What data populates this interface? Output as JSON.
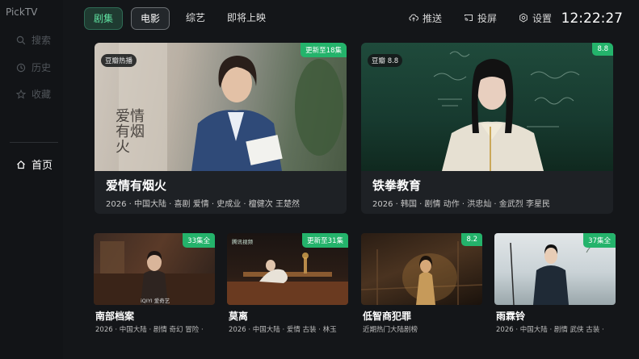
{
  "app": {
    "brand": "PickTV"
  },
  "sidebar": {
    "items": [
      {
        "label": "搜索",
        "icon": "search-icon"
      },
      {
        "label": "历史",
        "icon": "history-icon"
      },
      {
        "label": "收藏",
        "icon": "star-icon"
      }
    ],
    "home": {
      "label": "首页",
      "icon": "home-icon"
    }
  },
  "nav": {
    "tabs": [
      {
        "label": "剧集",
        "state": "active"
      },
      {
        "label": "电影",
        "state": "focused"
      },
      {
        "label": "综艺",
        "state": "normal"
      },
      {
        "label": "即将上映",
        "state": "normal"
      }
    ],
    "tools": [
      {
        "label": "推送",
        "icon": "upload-cloud-icon"
      },
      {
        "label": "投屏",
        "icon": "cast-icon"
      },
      {
        "label": "设置",
        "icon": "settings-icon"
      }
    ],
    "clock": "12:22:27"
  },
  "featured": [
    {
      "title": "爱情有烟火",
      "meta": "2026 · 中国大陆 · 喜剧 爱情 · 史成业 · 檀健次 王楚然",
      "left_badge": "豆瓣热播",
      "right_badge": "更新至18集",
      "poster_text": "爱情有烟火"
    },
    {
      "title": "铁拳教育",
      "meta": "2026 · 韩国 · 剧情 动作 · 洪忠灿 · 金武烈 李星民",
      "left_badge": "豆瓣 8.8",
      "right_badge": "8.8"
    }
  ],
  "shows": [
    {
      "title": "南部档案",
      "meta": "2026 · 中国大陆 · 剧情 奇幻 冒险 ·",
      "badge": "33集全",
      "poster_text": "iQIYI 爱奇艺"
    },
    {
      "title": "莫离",
      "meta": "2026 · 中国大陆 · 爱情 古装 · 林玉",
      "badge": "更新至31集",
      "poster_text": "腾讯视频"
    },
    {
      "title": "低智商犯罪",
      "meta": "近期热门大陆剧榜",
      "badge": "8.2"
    },
    {
      "title": "雨霖铃",
      "meta": "2026 · 中国大陆 · 剧情 武侠 古装 ·",
      "badge": "37集全"
    }
  ],
  "colors": {
    "accent": "#24b36b",
    "background": "#141619",
    "card": "#1e2125"
  }
}
